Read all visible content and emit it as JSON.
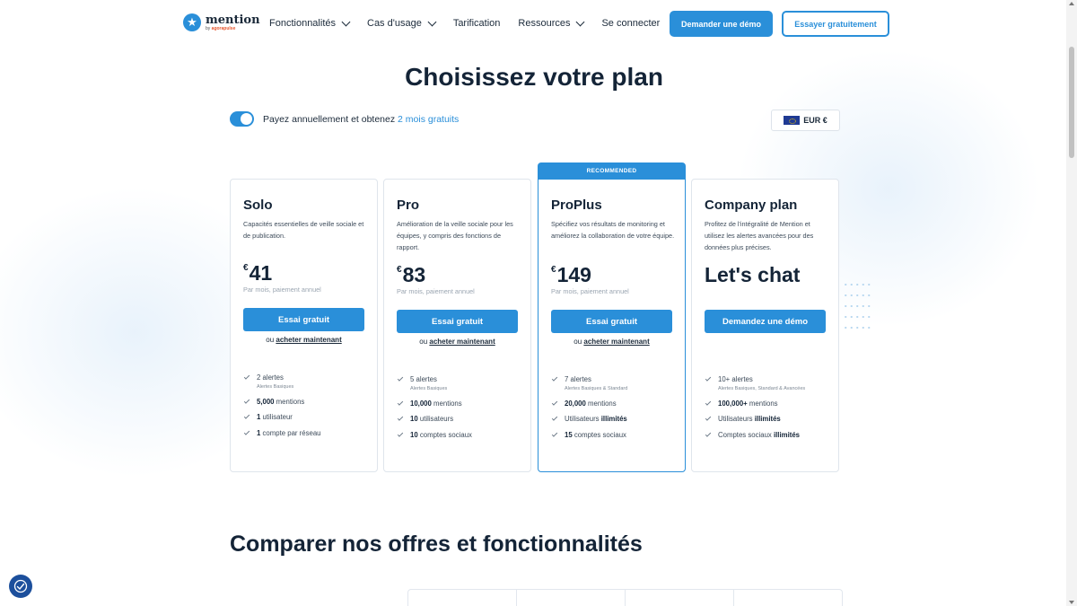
{
  "nav": {
    "logo_text": "mention",
    "logo_sub_prefix": "by",
    "logo_sub_brand": "agorapulse",
    "links": [
      "Fonctionnalités",
      "Cas d'usage",
      "Tarification",
      "Ressources",
      "Se connecter"
    ],
    "demo_button": "Demander une démo",
    "trial_button": "Essayer gratuitement"
  },
  "page_title": "Choisissez votre plan",
  "billing": {
    "toggle_on": true,
    "text": "Payez annuellement et obtenez ",
    "link": "2 mois gratuits"
  },
  "currency": {
    "label": "EUR €"
  },
  "recommended_label": "RECOMMENDED",
  "plans": [
    {
      "name": "Solo",
      "description": "Capacités essentielles de veille sociale et de publication.",
      "currency": "€",
      "price": "41",
      "price_sub": "Par mois, paiement annuel",
      "button": "Essai gratuit",
      "buy_prefix": "ou ",
      "buy_link": "acheter maintenant",
      "features": [
        {
          "bold": "",
          "text": "2 alertes",
          "sub": "Alertes Basiques"
        },
        {
          "bold": "5,000",
          "text": " mentions",
          "sub": ""
        },
        {
          "bold": "1",
          "text": " utilisateur",
          "sub": ""
        },
        {
          "bold": "1",
          "text": " compte par réseau",
          "sub": ""
        }
      ]
    },
    {
      "name": "Pro",
      "description": "Amélioration de la veille sociale pour les équipes, y compris des fonctions de rapport.",
      "currency": "€",
      "price": "83",
      "price_sub": "Par mois, paiement annuel",
      "button": "Essai gratuit",
      "buy_prefix": "ou ",
      "buy_link": "acheter maintenant",
      "features": [
        {
          "bold": "",
          "text": "5 alertes",
          "sub": "Alertes Basiques"
        },
        {
          "bold": "10,000",
          "text": " mentions",
          "sub": ""
        },
        {
          "bold": "10",
          "text": " utilisateurs",
          "sub": ""
        },
        {
          "bold": "10",
          "text": " comptes sociaux",
          "sub": ""
        }
      ]
    },
    {
      "name": "ProPlus",
      "description": "Spécifiez vos résultats de monitoring et améliorez la collaboration de votre équipe.",
      "currency": "€",
      "price": "149",
      "price_sub": "Par mois, paiement annuel",
      "button": "Essai gratuit",
      "buy_prefix": "ou ",
      "buy_link": "acheter maintenant",
      "features": [
        {
          "bold": "",
          "text": "7 alertes",
          "sub": "Alertes Basiques & Standard"
        },
        {
          "bold": "20,000",
          "text": " mentions",
          "sub": ""
        },
        {
          "bold": "",
          "text": "Utilisateurs ",
          "bold_after": "illimités",
          "sub": ""
        },
        {
          "bold": "15",
          "text": " comptes sociaux",
          "sub": ""
        }
      ]
    },
    {
      "name": "Company plan",
      "description": "Profitez de l'intégralité de Mention et utilisez les alertes avancées pour des données plus précises.",
      "price_text": "Let's chat",
      "button": "Demandez une démo",
      "features": [
        {
          "bold": "",
          "text": "10+ alertes",
          "sub": "Alertes Basiques, Standard & Avancées"
        },
        {
          "bold": "100,000+",
          "text": " mentions",
          "sub": ""
        },
        {
          "bold": "",
          "text": "Utilisateurs ",
          "bold_after": "illimités",
          "sub": ""
        },
        {
          "bold": "",
          "text": "Comptes sociaux ",
          "bold_after": "illimités",
          "sub": ""
        }
      ]
    }
  ],
  "compare_title": "Comparer nos offres et fonctionnalités",
  "icons": {
    "logo": "star-icon",
    "accessibility": "accessibility-icon",
    "check": "check-icon",
    "chevron": "chevron-down-icon"
  },
  "colors": {
    "accent": "#2a8fd9",
    "heading": "#142437"
  }
}
